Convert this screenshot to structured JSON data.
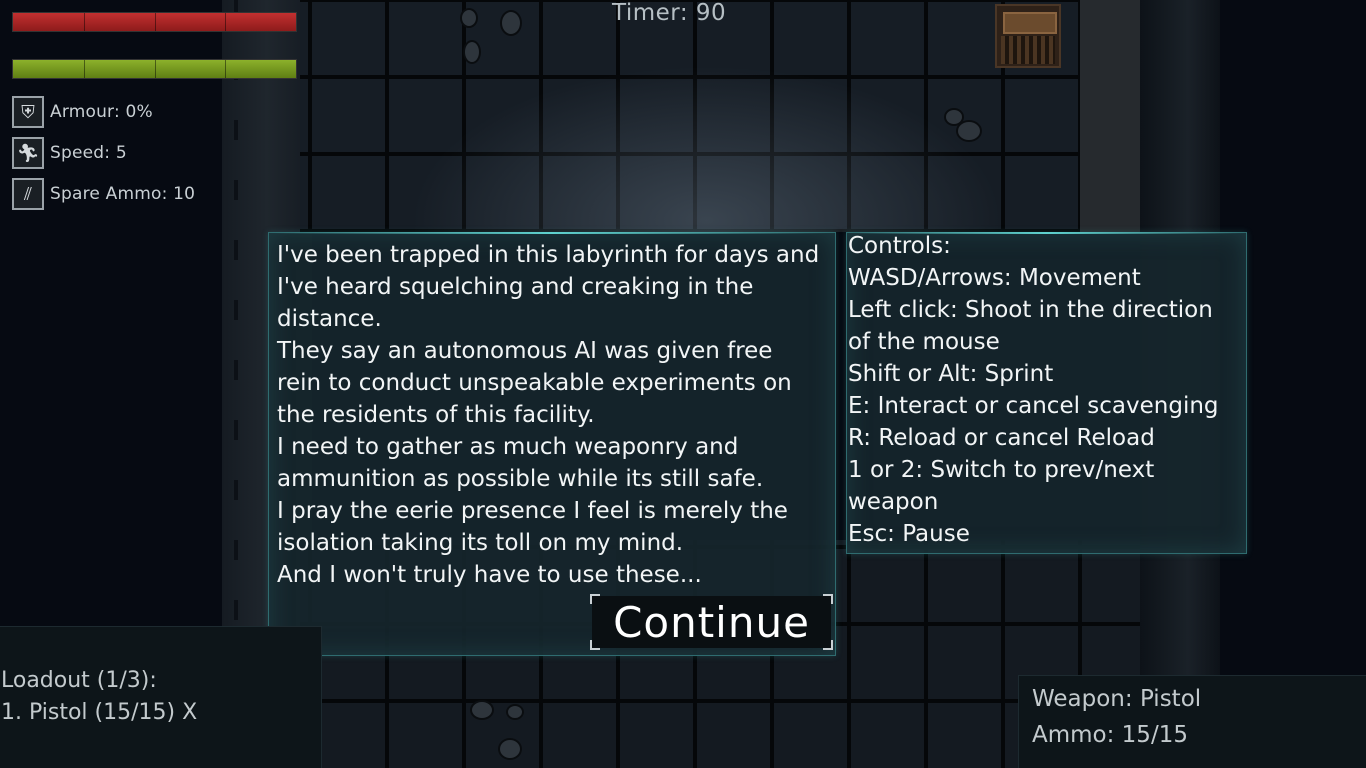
{
  "hud": {
    "timer": "Timer: 90",
    "health_fraction": 1.0,
    "stamina_fraction": 1.0,
    "stats": [
      {
        "icon": "shield-icon",
        "label": "Armour: 0%"
      },
      {
        "icon": "running-man-icon",
        "label": "Speed: 5"
      },
      {
        "icon": "ammo-icon",
        "label": "Spare Ammo: 10"
      }
    ]
  },
  "story": {
    "lines": [
      "I've been trapped in this labyrinth for days and",
      "I've heard squelching and creaking in the",
      "distance.",
      "They say an autonomous AI was given free",
      "rein to conduct unspeakable experiments on",
      "the residents of this facility.",
      "I need to gather as much weaponry and",
      "ammunition as possible while its still safe.",
      "I pray the eerie presence I feel is merely the",
      "isolation taking its toll on my mind.",
      "And I won't truly have to use these..."
    ],
    "continue_label": "Continue"
  },
  "controls": {
    "lines": [
      "Controls:",
      "WASD/Arrows: Movement",
      "Left click: Shoot in the direction",
      "of the mouse",
      "Shift or Alt: Sprint",
      "E: Interact or cancel scavenging",
      "R: Reload or cancel Reload",
      "1 or 2: Switch to prev/next",
      "weapon",
      "Esc: Pause"
    ]
  },
  "loadout": {
    "title": "Loadout (1/3):",
    "item": "1. Pistol (15/15) X"
  },
  "weapon": {
    "name": "Weapon: Pistol",
    "ammo": "Ammo: 15/15"
  },
  "colors": {
    "health": "#c23030",
    "stamina": "#8cb12b",
    "panel_border": "#2f6c70"
  }
}
